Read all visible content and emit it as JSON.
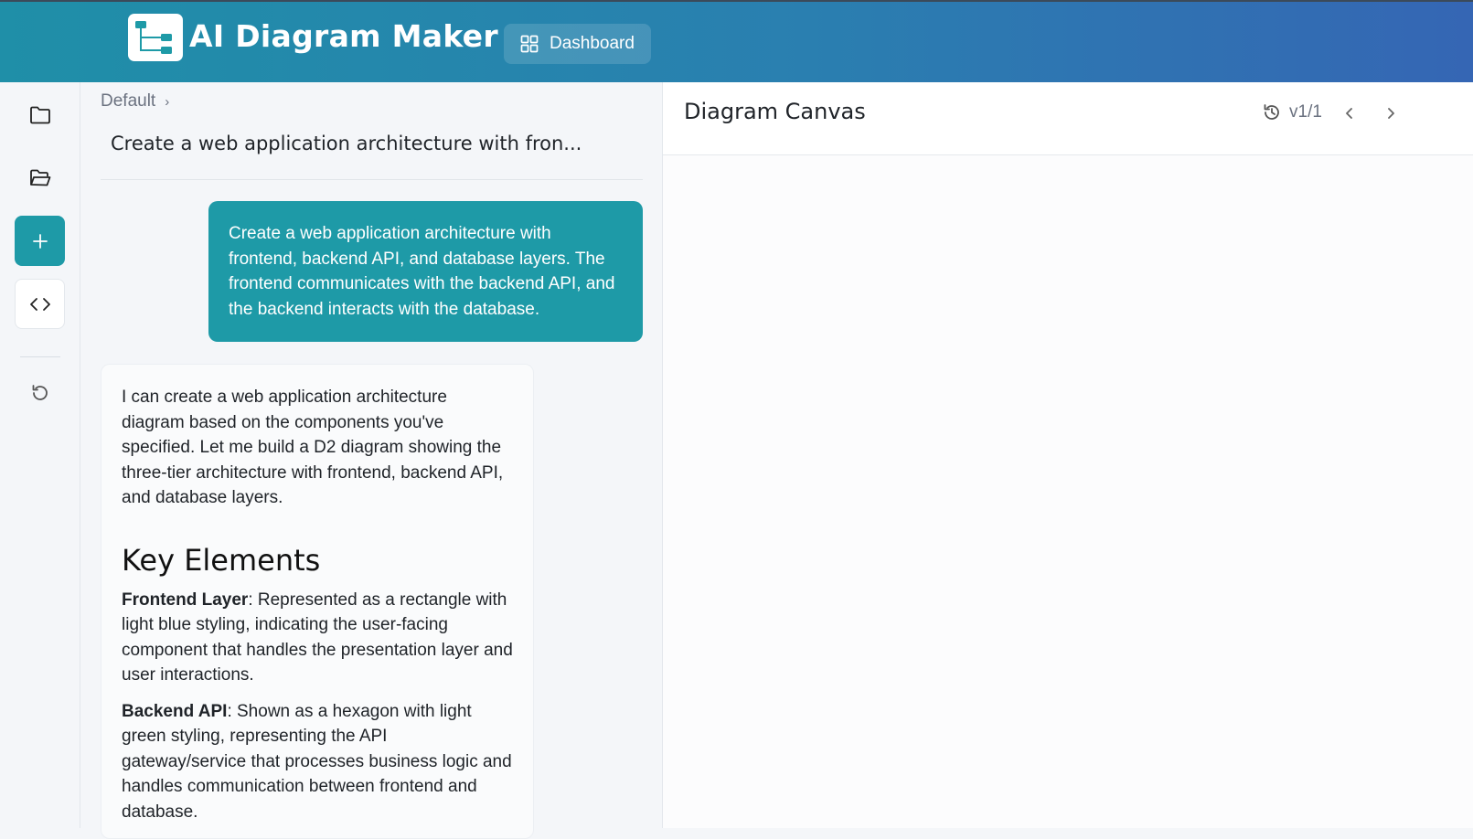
{
  "header": {
    "app_title": "AI Diagram Maker",
    "dashboard_label": "Dashboard"
  },
  "rail": {
    "items": [
      {
        "icon": "folder-icon"
      },
      {
        "icon": "folder-open-icon"
      },
      {
        "icon": "plus-icon"
      },
      {
        "icon": "code-icon"
      },
      {
        "icon": "reset-icon"
      }
    ]
  },
  "chat": {
    "breadcrumb": "Default",
    "title": "Create a web application architecture with fron...",
    "user_message": "Create a web application architecture with frontend, backend API, and database layers. The frontend communicates with the backend API, and the backend interacts with the database.",
    "ai_intro": "I can create a web application architecture diagram based on the components you've specified. Let me build a D2 diagram showing the three-tier architecture with frontend, backend API, and database layers.",
    "ai_heading": "Key Elements",
    "ai_items": [
      {
        "label": "Frontend Layer",
        "text": ": Represented as a rectangle with light blue styling, indicating the user-facing component that handles the presentation layer and user interactions."
      },
      {
        "label": "Backend API",
        "text": ": Shown as a hexagon with light green styling, representing the API gateway/service that processes business logic and handles communication between frontend and database."
      }
    ]
  },
  "canvas": {
    "title": "Diagram Canvas",
    "version": "v1/1"
  },
  "colors": {
    "accent": "#1e9aa7",
    "header_start": "#1f8fa8",
    "header_end": "#3566b4"
  }
}
